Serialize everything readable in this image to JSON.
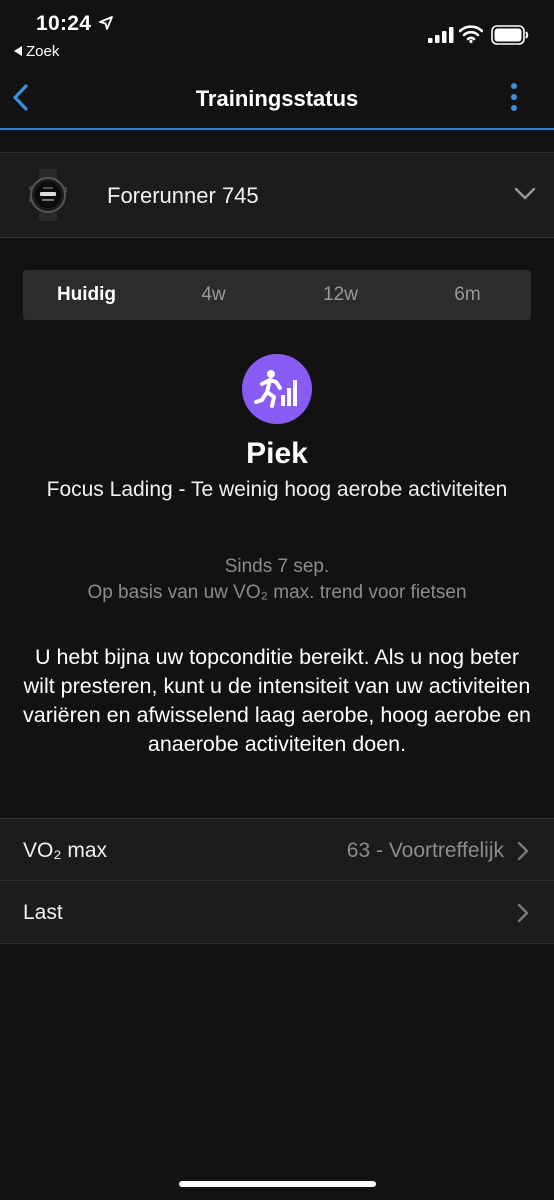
{
  "status_bar": {
    "time": "10:24",
    "back_app_label": "Zoek"
  },
  "nav": {
    "title": "Trainingsstatus"
  },
  "device": {
    "name": "Forerunner 745"
  },
  "period_tabs": [
    {
      "label": "Huidig",
      "active": true
    },
    {
      "label": "4w",
      "active": false
    },
    {
      "label": "12w",
      "active": false
    },
    {
      "label": "6m",
      "active": false
    }
  ],
  "training_status": {
    "name": "Piek",
    "subtitle": "Focus Lading - Te weinig hoog aerobe activiteiten",
    "since": "Sinds 7 sep.",
    "basis": "Op basis van uw VO₂ max. trend voor fietsen",
    "description": "U hebt bijna uw topconditie bereikt. Als u nog beter wilt presteren, kunt u de intensiteit van uw activiteiten variëren en afwisselend laag aerobe, hoog aerobe en anaerobe activiteiten doen.",
    "badge_color": "#8a5cf6"
  },
  "metrics": [
    {
      "label": "VO₂ max",
      "value": "63 - Voortreffelijk"
    },
    {
      "label": "Last",
      "value": ""
    }
  ],
  "colors": {
    "background": "#121212",
    "row_background": "#1c1c1c",
    "accent": "#3b7fc4",
    "muted_text": "#8c8c8c"
  }
}
